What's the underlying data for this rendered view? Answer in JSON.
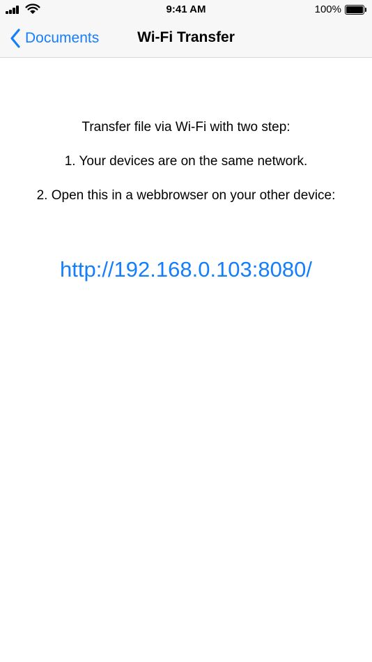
{
  "status_bar": {
    "time": "9:41 AM",
    "battery_percent": "100%",
    "battery_level": 1.0,
    "signal_icon": "cellular-signal-icon",
    "wifi_icon": "wifi-icon",
    "battery_icon": "battery-icon"
  },
  "nav": {
    "back_label": "Documents",
    "back_icon": "chevron-left-icon",
    "title": "Wi-Fi Transfer"
  },
  "content": {
    "heading": "Transfer file via Wi-Fi with two step:",
    "step1": "1. Your devices are on the same network.",
    "step2": "2. Open this in a webbrowser on your other device:",
    "url": "http://192.168.0.103:8080/"
  },
  "colors": {
    "accent": "#157efb",
    "nav_background": "#f7f7f7",
    "background": "#ffffff"
  }
}
